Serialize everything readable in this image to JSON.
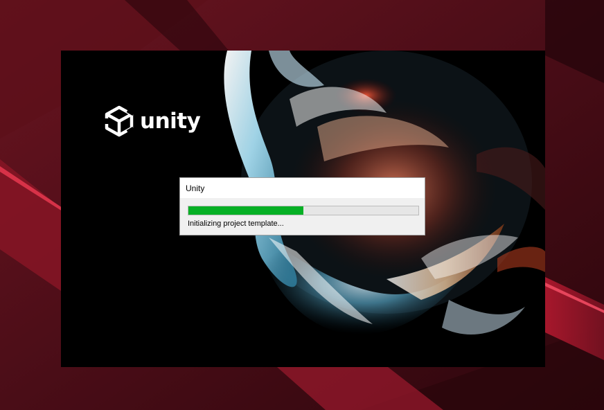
{
  "splash": {
    "wordmark": "unity",
    "logo_icon": "unity-cube-icon"
  },
  "dialog": {
    "title": "Unity",
    "status": "Initializing project template...",
    "progress": 0.5,
    "progress_color": "#06b025"
  },
  "colors": {
    "desktop_background": "#3e0a12",
    "desktop_accent": "#c2263a",
    "splash_background": "#000000"
  }
}
